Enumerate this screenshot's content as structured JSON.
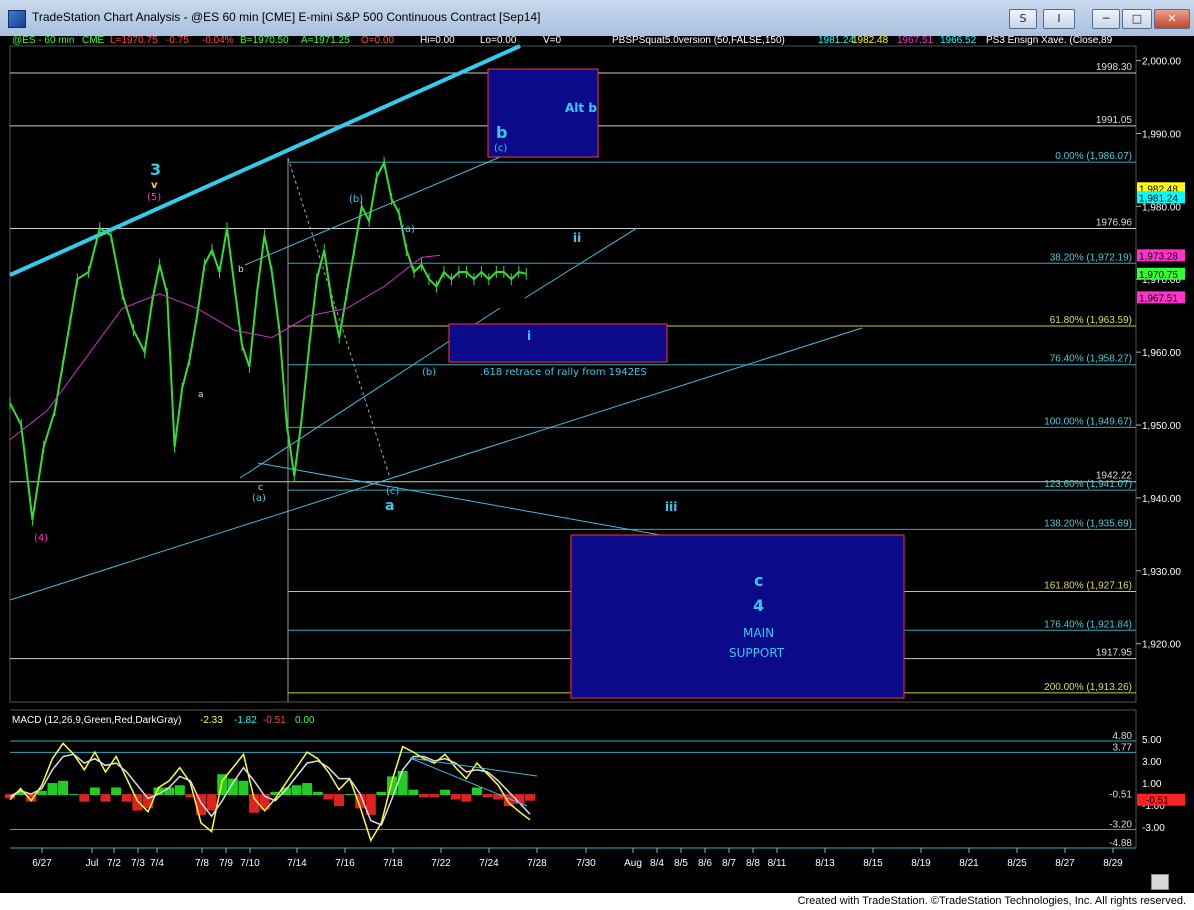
{
  "window": {
    "title": "TradeStation Chart Analysis - @ES 60 min [CME] E-mini S&P 500 Continuous Contract [Sep14]",
    "btn_s": "S",
    "btn_menu": "I",
    "btn_min": "─",
    "btn_max": "□",
    "btn_close": "✕"
  },
  "header": {
    "symbol": "@ES - 60 min",
    "exchange": "CME",
    "last": "L=1970.75",
    "change": "-0.75",
    "pct": "-0.04%",
    "bid": "B=1970.50",
    "ask": "A=1971.25",
    "open": "O=0.00",
    "hi": "Hi=0.00",
    "lo": "Lo=0.00",
    "vol": "V=0",
    "study": "PBSPSquat5.0version (50,FALSE,150)",
    "v1": "1981.24",
    "v2": "1982.48",
    "v3": "1967.51",
    "v4": "1966.52",
    "study2": "PS3 Ensign Xave. (Close,89"
  },
  "macd_header": {
    "label": "MACD (12,26,9,Green,Red,DarkGray)",
    "v1": "-2.33",
    "v2": "-1.82",
    "v3": "-0.51",
    "v4": "0.00"
  },
  "footer": {
    "text": "Created with TradeStation. ©TradeStation Technologies, Inc. All rights reserved."
  },
  "chart_data": [
    {
      "type": "candlestick",
      "ylim": [
        1912,
        2002
      ],
      "y_ticks": [
        "2,000.00",
        "1,990.00",
        "1,980.00",
        "1,970.00",
        "1,960.00",
        "1,950.00",
        "1,940.00",
        "1,930.00",
        "1,920.00"
      ],
      "x_ticks": [
        "6/27",
        "Jul",
        "7/2",
        "7/3",
        "7/4",
        "7/8",
        "7/9",
        "7/10",
        "7/14",
        "7/16",
        "7/18",
        "7/22",
        "7/24",
        "7/28",
        "7/30",
        "Aug",
        "8/4",
        "8/5",
        "8/6",
        "8/7",
        "8/8",
        "8/11",
        "8/13",
        "8/15",
        "8/19",
        "8/21",
        "8/25",
        "8/27",
        "8/29"
      ],
      "series": [
        {
          "name": "price",
          "color": "#33dd33",
          "x": [
            0,
            3,
            6,
            9,
            12,
            14,
            16,
            18,
            21,
            24,
            27,
            30,
            33,
            36,
            38,
            40,
            42,
            44,
            46,
            48,
            50,
            52,
            54,
            56,
            58,
            60,
            62,
            64,
            66,
            68,
            70,
            72,
            74,
            76,
            78,
            80,
            82,
            84,
            86,
            88,
            90,
            92,
            94,
            96,
            98,
            100,
            102,
            104,
            106,
            108,
            110,
            112,
            114,
            116,
            118,
            120,
            122,
            124,
            126,
            128,
            130,
            132,
            134,
            136,
            138
          ],
          "y": [
            1953,
            1950,
            1937,
            1947,
            1952,
            1958,
            1964,
            1970,
            1971,
            1977,
            1976,
            1968,
            1963,
            1960,
            1967,
            1972,
            1968,
            1947,
            1955,
            1959,
            1965,
            1972,
            1974,
            1971,
            1977,
            1969,
            1961,
            1958,
            1968,
            1976,
            1971,
            1963,
            1950,
            1943,
            1951,
            1961,
            1970,
            1974,
            1967,
            1962,
            1968,
            1974,
            1980,
            1978,
            1984,
            1986,
            1981,
            1979,
            1974,
            1971,
            1972,
            1970,
            1969,
            1971,
            1970,
            1971,
            1971,
            1970,
            1971,
            1970,
            1971,
            1971,
            1970,
            1971,
            1970.75
          ]
        },
        {
          "name": "average",
          "color": "#cc33cc",
          "x": [
            0,
            10,
            20,
            30,
            40,
            50,
            60,
            70,
            80,
            90,
            100,
            110,
            115
          ],
          "y": [
            1948,
            1952,
            1959,
            1966,
            1968,
            1966,
            1963,
            1962,
            1965,
            1966,
            1969,
            1973,
            1973.28
          ]
        }
      ],
      "value_labels": [
        {
          "text": "1998.30",
          "y": 1998.3
        },
        {
          "text": "1991.05",
          "y": 1991.05
        },
        {
          "text": "0.00% (1,986.07)",
          "y": 1986.07
        },
        {
          "text": "1976.96",
          "y": 1976.96
        },
        {
          "text": "38.20% (1,972.19)",
          "y": 1972.19
        },
        {
          "text": "61.80% (1,963.59)",
          "y": 1963.59
        },
        {
          "text": "76.40% (1,958.27)",
          "y": 1958.27
        },
        {
          "text": "100.00% (1,949.67)",
          "y": 1949.67
        },
        {
          "text": "1942.22",
          "y": 1942.22
        },
        {
          "text": "123.60% (1,941.07)",
          "y": 1941.07
        },
        {
          "text": "138.20% (1,935.69)",
          "y": 1935.69
        },
        {
          "text": "161.80% (1,927.16)",
          "y": 1927.16
        },
        {
          "text": "176.40% (1,921.84)",
          "y": 1921.84
        },
        {
          "text": "1917.95",
          "y": 1917.95
        },
        {
          "text": "200.00% (1,913.26)",
          "y": 1913.26
        }
      ],
      "price_tags": [
        {
          "text": "1,982.48",
          "y": 1982.48,
          "color": "#ffff00"
        },
        {
          "text": "1,981.24",
          "y": 1981.24,
          "color": "#00ffff"
        },
        {
          "text": "1,973.28",
          "y": 1973.28,
          "color": "#ff33cc"
        },
        {
          "text": "1,970.75",
          "y": 1970.75,
          "color": "#33ff33"
        },
        {
          "text": "1,967.51",
          "y": 1967.51,
          "color": "#ff33cc"
        }
      ],
      "wave_labels": [
        "3",
        "v",
        "(5)",
        "(4)",
        "b",
        "a",
        "c",
        "(a)",
        "(b)",
        "(a)",
        "(b)",
        "(c)",
        "a",
        "b",
        "(c)",
        "Alt b",
        "ii",
        "i",
        "iii",
        "c",
        "4",
        "MAIN",
        "SUPPORT"
      ],
      "annotations": [
        ".618 retrace of rally from 1942ES"
      ]
    },
    {
      "type": "macd",
      "ylim": [
        -4.88,
        5.8
      ],
      "y_ticks": [
        "5.00",
        "3.00",
        "1.00",
        "-1.00",
        "-3.00"
      ],
      "levels": [
        {
          "text": "4.80",
          "y": 4.8
        },
        {
          "text": "3.77",
          "y": 3.77
        },
        {
          "text": "-0.51",
          "y": -0.51
        },
        {
          "text": "-3.20",
          "y": -3.2
        },
        {
          "text": "-4.88",
          "y": -4.88
        }
      ],
      "macd_line_y": [
        -0.5,
        0.5,
        -0.6,
        0.8,
        3.2,
        4.6,
        3.6,
        2.2,
        3.8,
        2.0,
        3.4,
        1.4,
        -0.6,
        -1.6,
        0.6,
        1.2,
        2.4,
        1.0,
        -2.6,
        -3.4,
        1.2,
        2.4,
        3.6,
        -0.4,
        -1.5,
        -0.4,
        1.0,
        2.4,
        3.8,
        3.2,
        2.0,
        0.4,
        1.4,
        -1.2,
        -4.2,
        -2.6,
        1.2,
        4.3,
        3.8,
        3.2,
        2.8,
        3.6,
        2.4,
        1.4,
        2.8,
        1.8,
        0.8,
        -0.8,
        -1.6,
        -2.33
      ],
      "signal_line_y": [
        -0.2,
        0.3,
        0.0,
        0.5,
        2.2,
        3.4,
        3.6,
        2.8,
        3.2,
        2.6,
        2.8,
        2.0,
        0.8,
        -0.4,
        0.0,
        0.6,
        1.6,
        1.2,
        -0.8,
        -2.0,
        -0.6,
        1.0,
        2.4,
        1.2,
        -0.2,
        -0.6,
        0.4,
        1.6,
        2.8,
        3.0,
        2.4,
        1.4,
        1.4,
        0.0,
        -2.4,
        -2.8,
        -0.4,
        2.2,
        3.4,
        3.4,
        3.0,
        3.2,
        2.8,
        2.0,
        2.2,
        2.0,
        1.2,
        0.2,
        -0.8,
        -1.82
      ]
    }
  ]
}
